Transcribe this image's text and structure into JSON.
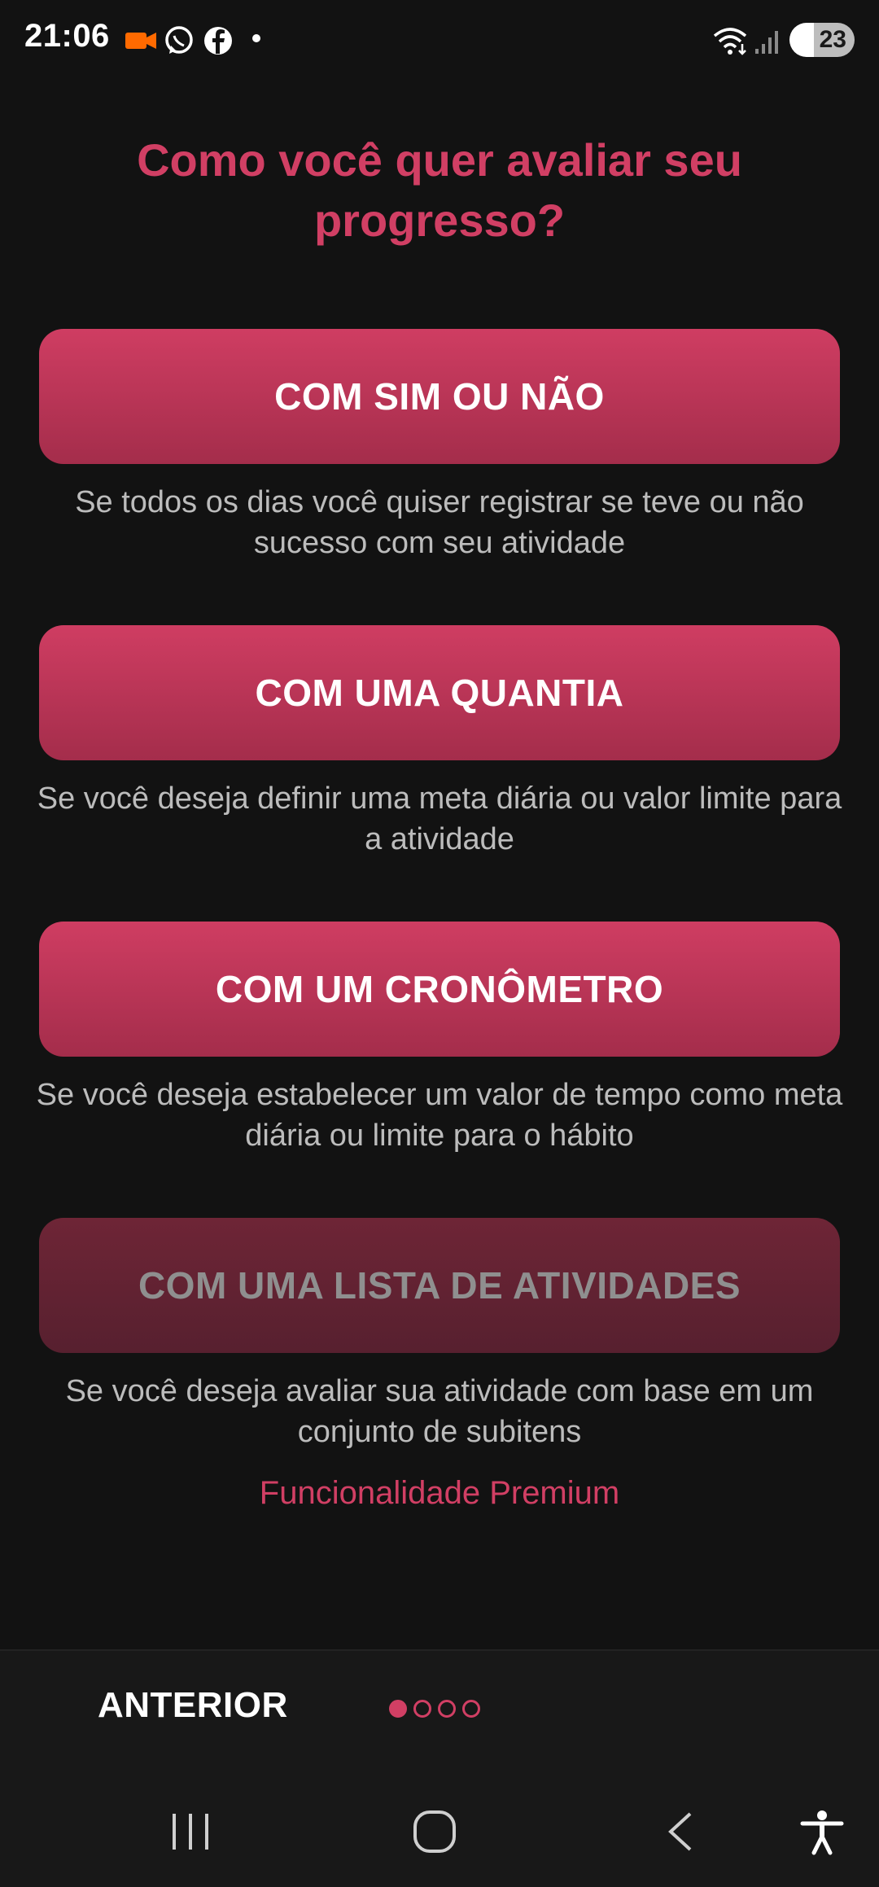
{
  "status_bar": {
    "time": "21:06",
    "battery_level": "23",
    "icons": [
      "video-camera-icon",
      "whatsapp-icon",
      "facebook-icon",
      "notification-dot-icon",
      "wifi-icon",
      "signal-icon",
      "battery-charging-icon"
    ]
  },
  "title": "Como você quer avaliar seu progresso?",
  "options": [
    {
      "label": "COM SIM OU NÃO",
      "description": "Se todos os dias você quiser registrar se teve ou não sucesso com seu atividade"
    },
    {
      "label": "COM UMA QUANTIA",
      "description": "Se você deseja definir uma meta diária ou valor limite para a atividade"
    },
    {
      "label": "COM UM CRONÔMETRO",
      "description": "Se você deseja estabelecer um valor de tempo como meta diária ou limite para o hábito"
    },
    {
      "label": "COM UMA LISTA DE ATIVIDADES",
      "description": "Se você deseja avaliar sua atividade com base em um conjunto de subitens",
      "premium_label": "Funcionalidade Premium"
    }
  ],
  "footer": {
    "prev_label": "ANTERIOR",
    "page_indicator": {
      "current": 1,
      "total": 4
    }
  },
  "system_nav": [
    "recent-apps-icon",
    "home-icon",
    "back-icon",
    "accessibility-icon"
  ],
  "colors": {
    "accent": "#d13f64",
    "background": "#121212",
    "button_top": "#cf3d62",
    "button_bottom": "#a42d4b",
    "disabled_button": "#6e2536",
    "description_text": "#bcbcbc"
  }
}
